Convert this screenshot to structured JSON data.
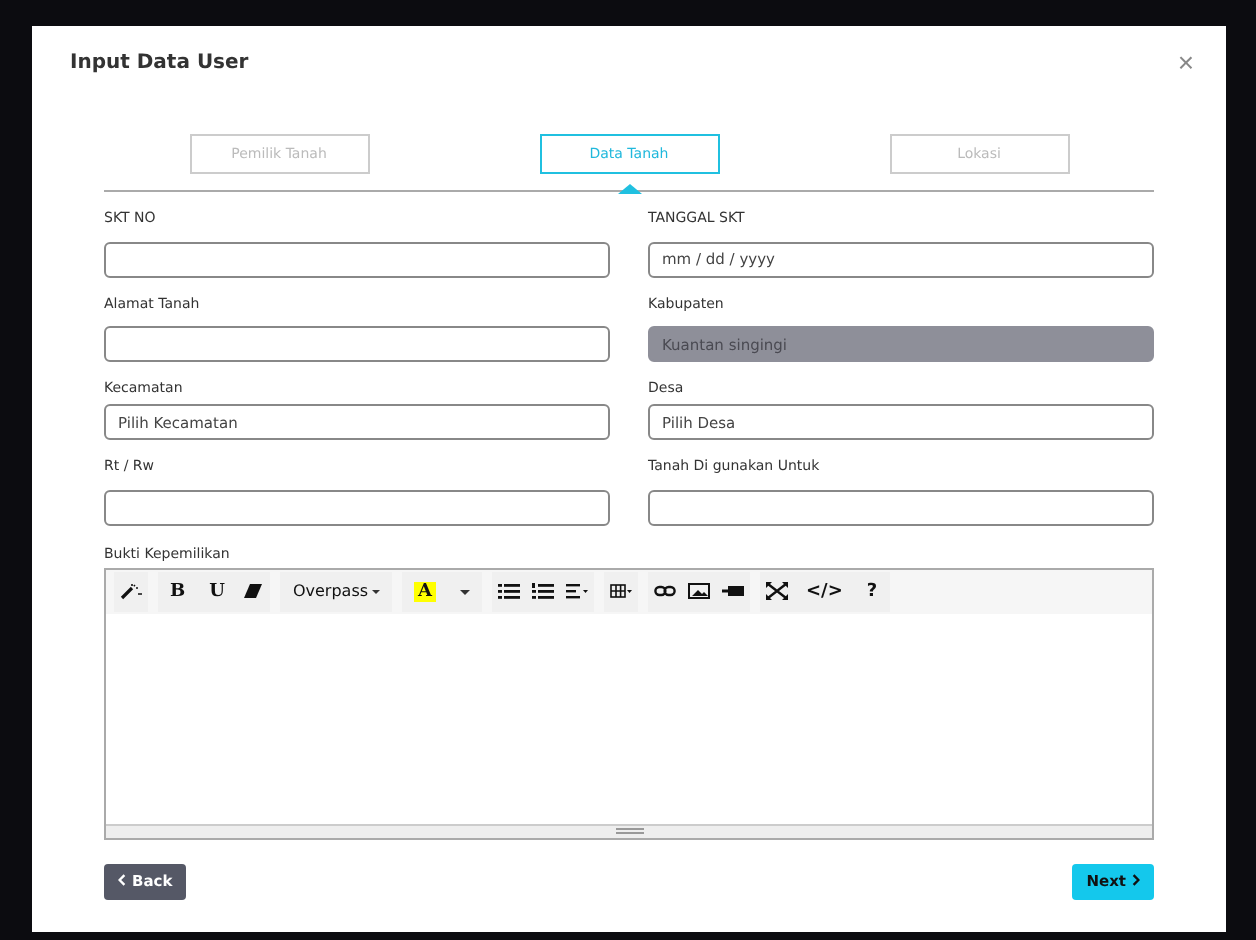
{
  "dialog": {
    "title": "Input Data User",
    "close": "×"
  },
  "tabs": [
    {
      "label": "Pemilik Tanah",
      "selected": false
    },
    {
      "label": "Data Tanah",
      "selected": true
    },
    {
      "label": "Lokasi",
      "selected": false
    }
  ],
  "fields": [
    {
      "label": "SKT NO",
      "kind": "text"
    },
    {
      "label": "TANGGAL SKT",
      "kind": "date",
      "placeholder": "mm / dd / yyyy"
    },
    {
      "label": "Alamat Tanah",
      "kind": "text"
    },
    {
      "label": "Kabupaten",
      "kind": "text",
      "value": "Kuantan singingi",
      "disabled": true
    },
    {
      "label": "Kecamatan",
      "kind": "select",
      "value": "Pilih Kecamatan"
    },
    {
      "label": "Desa",
      "kind": "select",
      "value": "Pilih Desa"
    },
    {
      "label": "Rt / Rw",
      "kind": "text"
    },
    {
      "label": "Tanah Di gunakan Untuk",
      "kind": "text"
    }
  ],
  "editor": {
    "label": "Bukti Kepemilikan",
    "bold": "B",
    "underline": "U",
    "font": "Overpass",
    "text_color": "A",
    "code": "</>",
    "help": "?"
  },
  "buttons": {
    "back": "Back",
    "next": "Next"
  }
}
